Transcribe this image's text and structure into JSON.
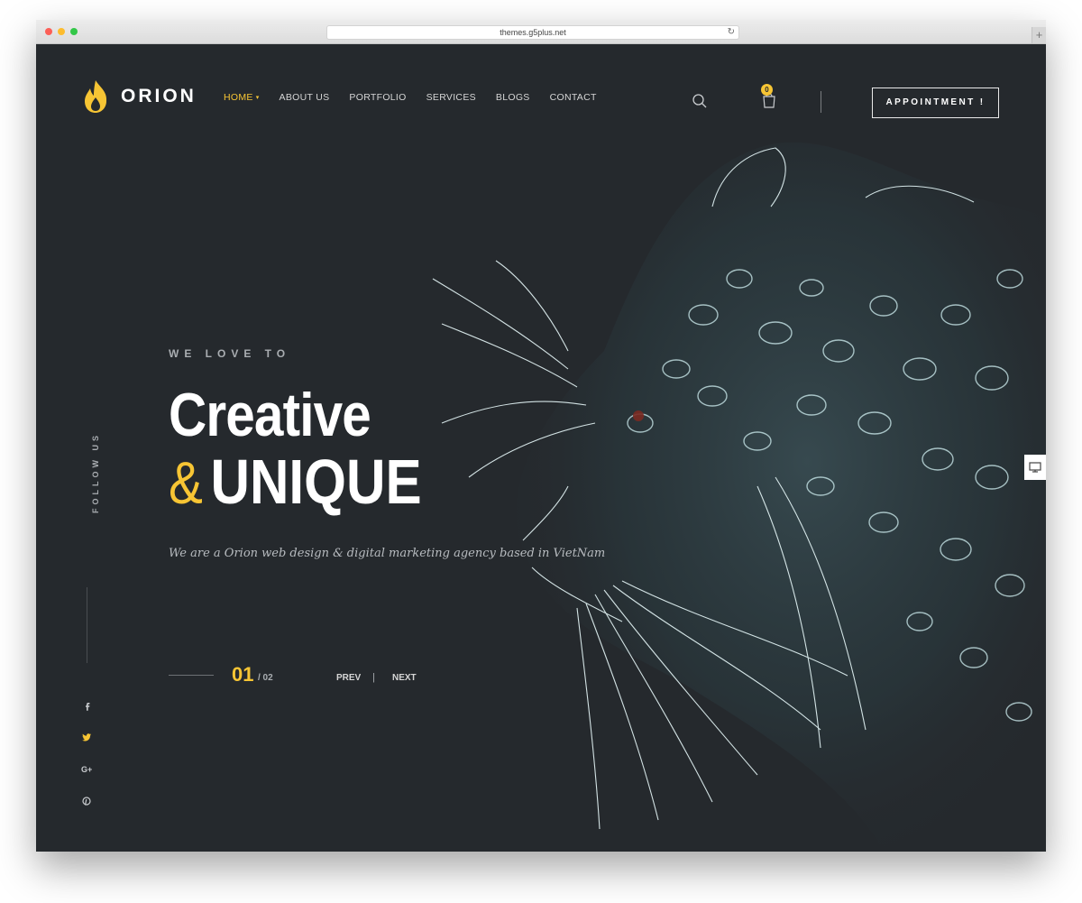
{
  "browser": {
    "url": "themes.g5plus.net",
    "reload_glyph": "↻",
    "newtab_glyph": "+"
  },
  "brand": {
    "name": "ORION",
    "accent_color": "#f7c534",
    "background_color": "#25292d"
  },
  "nav": {
    "items": [
      {
        "label": "HOME",
        "active": true,
        "has_dropdown": true
      },
      {
        "label": "ABOUT US"
      },
      {
        "label": "PORTFOLIO"
      },
      {
        "label": "SERVICES"
      },
      {
        "label": "BLOGS"
      },
      {
        "label": "CONTACT"
      }
    ],
    "dropdown_glyph": "▾"
  },
  "header": {
    "cart_count": "0",
    "appointment_label": "APPOINTMENT !",
    "icons": [
      "search-icon",
      "cart-icon"
    ]
  },
  "hero": {
    "eyebrow": "WE LOVE TO",
    "headline_line1": "Creative",
    "headline_amp": "&",
    "headline_line2": "UNIQUE",
    "tagline": "We are a Orion web design & digital marketing agency based in VietNam"
  },
  "slider": {
    "current": "01",
    "total": "/ 02",
    "prev_label": "PREV",
    "separator": "|",
    "next_label": "NEXT"
  },
  "social": {
    "follow_label": "FOLLOW US",
    "icons": [
      "facebook-icon",
      "twitter-icon",
      "google-plus-icon",
      "pinterest-icon"
    ]
  },
  "side_tab": {
    "icon": "monitor-icon"
  }
}
